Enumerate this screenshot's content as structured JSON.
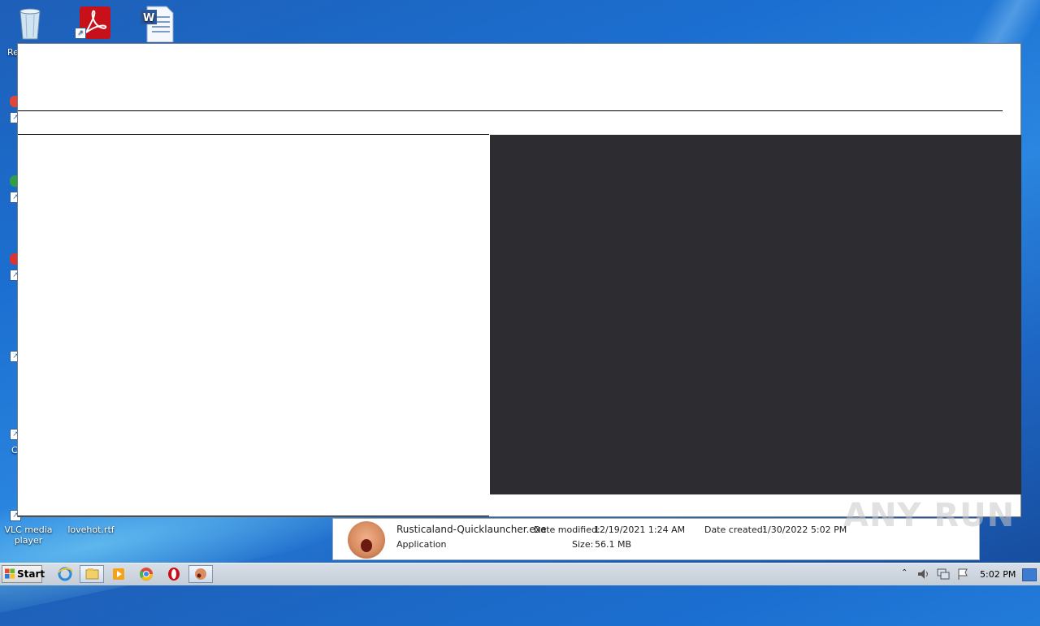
{
  "desktop": {
    "icons": [
      {
        "label": "Re"
      },
      {
        "label": ""
      },
      {
        "label": ""
      }
    ],
    "bottom_icons": [
      {
        "label": "VLC media player"
      },
      {
        "label": "lovehot.rtf"
      }
    ],
    "stubs": [
      "C",
      "C"
    ]
  },
  "details": {
    "filename": "Rusticaland-Quicklauncher.exe",
    "type": "Application",
    "date_modified_label": "Date modified:",
    "date_modified": "12/19/2021 1:24 AM",
    "size_label": "Size:",
    "size": "56.1 MB",
    "date_created_label": "Date created:",
    "date_created": "1/30/2022 5:02 PM"
  },
  "taskbar": {
    "start_label": "Start",
    "clock": "5:02 PM"
  },
  "watermark": "ANY RUN"
}
